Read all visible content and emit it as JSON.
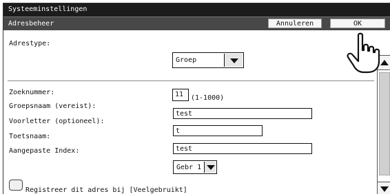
{
  "window": {
    "title": "Systeeminstellingen"
  },
  "header": {
    "title": "Adresbeheer",
    "cancel_label": "Annuleren",
    "ok_label": "OK"
  },
  "form": {
    "address_type": {
      "label": "Adrestype:",
      "value": "Groep"
    },
    "search_number": {
      "label": "Zoeknummer:",
      "value": "11",
      "range": "(1-1000)"
    },
    "group_name": {
      "label": "Groepsnaam (vereist):",
      "value": "test"
    },
    "initial": {
      "label": "Voorletter (optioneel):",
      "value": "t"
    },
    "key_name": {
      "label": "Toetsnaam:",
      "value": "test"
    },
    "custom_index": {
      "label": "Aangepaste Index:",
      "value": "Gebr 1"
    },
    "register_frequent": {
      "label": "Registreer dit adres bij [Veelgebruikt]",
      "checked": false
    }
  },
  "icons": {
    "pointer": "hand-pointer-icon",
    "scroll_up": "triangle-up-icon",
    "scroll_down": "triangle-down-icon",
    "dropdown": "triangle-down-icon"
  }
}
